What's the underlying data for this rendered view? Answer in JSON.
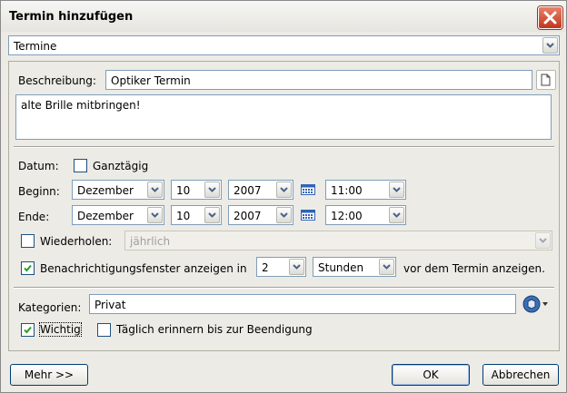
{
  "window": {
    "title": "Termin hinzufügen"
  },
  "top": {
    "category_select": "Termine"
  },
  "description": {
    "label": "Beschreibung:",
    "value": "Optiker Termin",
    "notes": "alte Brille mitbringen!"
  },
  "date": {
    "label": "Datum:",
    "allday_label": "Ganztägig",
    "begin": {
      "label": "Beginn:",
      "month": "Dezember",
      "day": "10",
      "year": "2007",
      "time": "11:00"
    },
    "end": {
      "label": "Ende:",
      "month": "Dezember",
      "day": "10",
      "year": "2007",
      "time": "12:00"
    }
  },
  "repeat": {
    "label": "Wiederholen:",
    "value": "jährlich"
  },
  "notify": {
    "label": "Benachrichtigungsfenster anzeigen in",
    "amount": "2",
    "unit": "Stunden",
    "suffix": "vor dem Termin anzeigen."
  },
  "categories": {
    "label": "Kategorien:",
    "value": "Privat"
  },
  "flags": {
    "important_label": "Wichtig",
    "daily_reminder_label": "Täglich erinnern bis zur Beendigung"
  },
  "buttons": {
    "more": "Mehr >>",
    "ok": "OK",
    "cancel": "Abbrechen"
  }
}
